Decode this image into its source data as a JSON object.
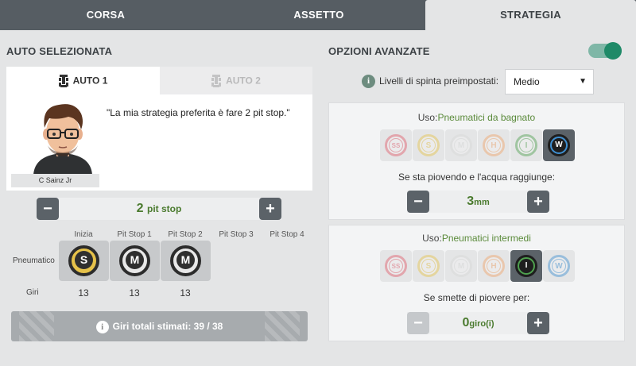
{
  "tabs": [
    {
      "label": "CORSA",
      "active": false
    },
    {
      "label": "ASSETTO",
      "active": false
    },
    {
      "label": "STRATEGIA",
      "active": true
    }
  ],
  "left": {
    "title": "AUTO SELEZIONATA",
    "car_tabs": [
      {
        "label": "AUTO 1",
        "active": true
      },
      {
        "label": "AUTO 2",
        "active": false
      }
    ],
    "quote": "\"La mia strategia preferita è fare 2 pit stop.\"",
    "driver_name": "C Sainz Jr",
    "pit_stop": {
      "value": "2",
      "unit": "pit stop",
      "minus": "−",
      "plus": "+"
    },
    "stint_headers": [
      "Inizia",
      "Pit Stop 1",
      "Pit Stop 2",
      "Pit Stop 3",
      "Pit Stop 4"
    ],
    "row_tyre_label": "Pneumatico",
    "row_laps_label": "Giri",
    "stints": [
      {
        "tyre": "S",
        "laps": "13"
      },
      {
        "tyre": "M",
        "laps": "13"
      },
      {
        "tyre": "M",
        "laps": "13"
      }
    ],
    "total_info_icon": "i",
    "total_text": "Giri totali stimati: 39 / 38"
  },
  "right": {
    "title": "OPZIONI AVANZATE",
    "toggle_on": true,
    "preset_info_icon": "i",
    "preset_label": "Livelli di spinta preimpostati:",
    "preset_value": "Medio",
    "preset_arrow": "▼",
    "wet": {
      "title_prefix": "Uso:",
      "title_highlight": "Pneumatici da bagnato",
      "tyres": [
        "SS",
        "S",
        "M",
        "H",
        "I",
        "W"
      ],
      "selected": "W",
      "condition": "Se sta piovendo e l'acqua raggiunge:",
      "value": "3",
      "unit": "mm",
      "minus": "−",
      "plus": "+"
    },
    "inter": {
      "title_prefix": "Uso:",
      "title_highlight": "Pneumatici intermedi",
      "tyres": [
        "SS",
        "S",
        "M",
        "H",
        "I",
        "W"
      ],
      "selected": "I",
      "condition": "Se smette di piovere per:",
      "value": "0",
      "unit": "giro(i)",
      "minus": "−",
      "plus": "+"
    }
  },
  "colors": {
    "SS": "#e05a6a",
    "S": "#e6c24a",
    "M": "#d8d8d8",
    "H": "#f0a46a",
    "I": "#4fa04f",
    "W": "#3f8fd0",
    "accent_green": "#4a7a2e",
    "toggle": "#1f8a68"
  }
}
